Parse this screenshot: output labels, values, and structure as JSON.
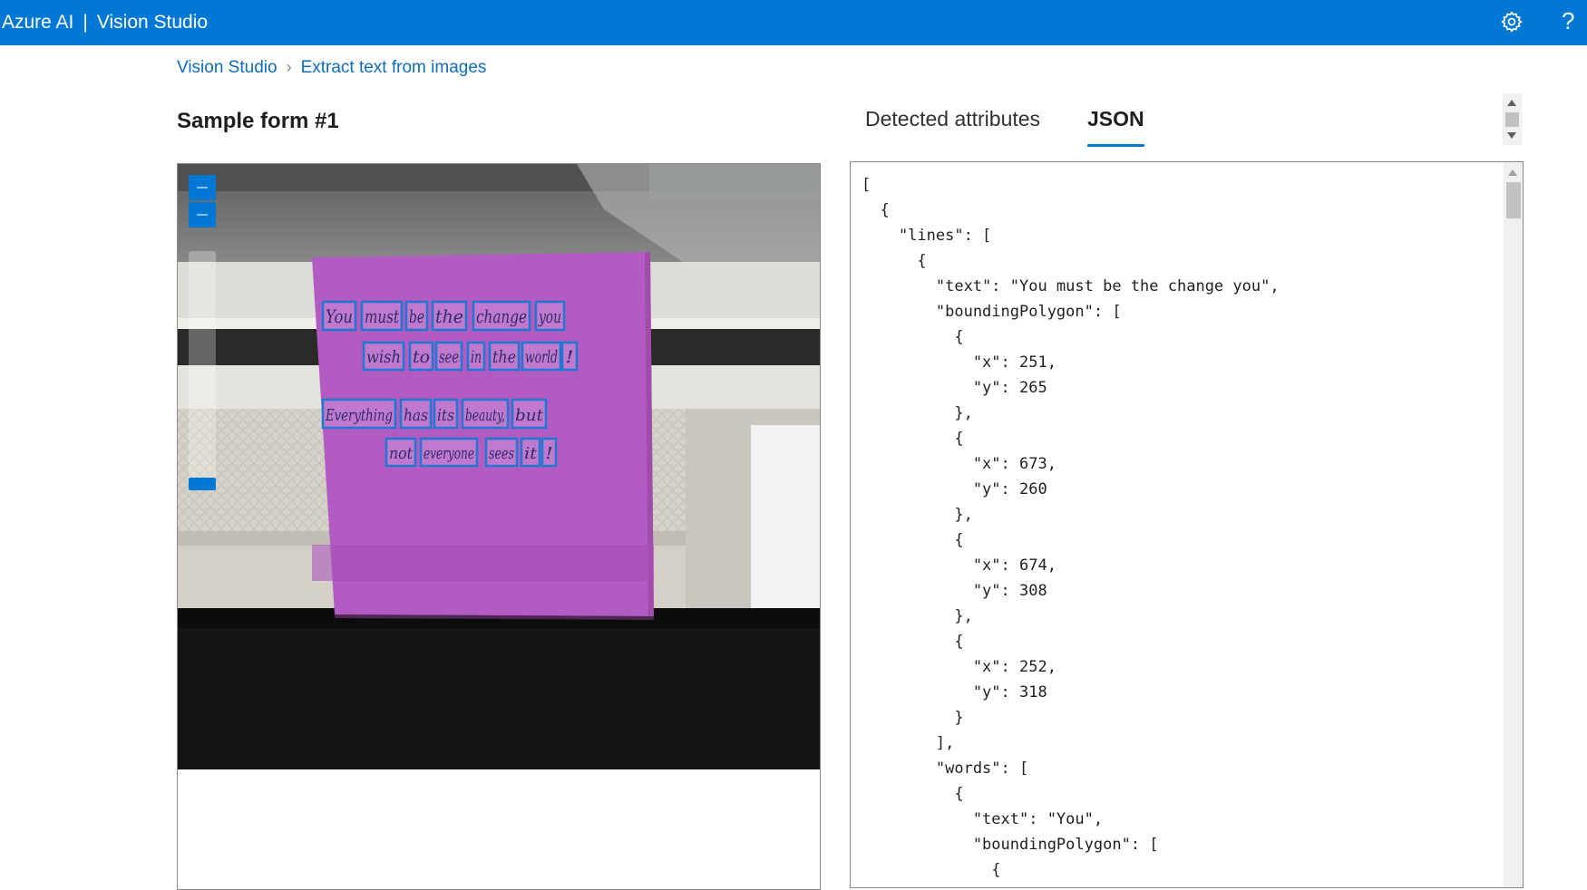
{
  "header": {
    "brand": "Azure AI",
    "separator": "|",
    "product": "Vision Studio",
    "settings_icon": "gear-icon",
    "help_label": "?"
  },
  "breadcrumb": {
    "items": [
      "Vision Studio",
      "Extract text from images"
    ],
    "separator": "›"
  },
  "main": {
    "title": "Sample form #1",
    "tabs": [
      {
        "label": "Detected attributes",
        "selected": false
      },
      {
        "label": "JSON",
        "selected": true
      }
    ]
  },
  "sample_image": {
    "note_lines": [
      [
        "You",
        "must",
        "be",
        "the",
        "change",
        "you"
      ],
      [
        "wish",
        "to",
        "see",
        "in",
        "the",
        "world",
        "!"
      ],
      [
        "Everything",
        "has",
        "its",
        "beauty,",
        "but"
      ],
      [
        "not",
        "everyone",
        "sees",
        "it",
        "!"
      ]
    ],
    "note_color": "#b25bc2",
    "box_color": "#1f78d1",
    "zoom_controls": [
      "zoom-in-button",
      "zoom-out-button",
      "zoom-slider"
    ]
  },
  "json_output": {
    "text": "[\n  {\n    \"lines\": [\n      {\n        \"text\": \"You must be the change you\",\n        \"boundingPolygon\": [\n          {\n            \"x\": 251,\n            \"y\": 265\n          },\n          {\n            \"x\": 673,\n            \"y\": 260\n          },\n          {\n            \"x\": 674,\n            \"y\": 308\n          },\n          {\n            \"x\": 252,\n            \"y\": 318\n          }\n        ],\n        \"words\": [\n          {\n            \"text\": \"You\",\n            \"boundingPolygon\": [\n              {"
  },
  "colors": {
    "accent": "#0078d4",
    "link": "#0f6cbd"
  }
}
